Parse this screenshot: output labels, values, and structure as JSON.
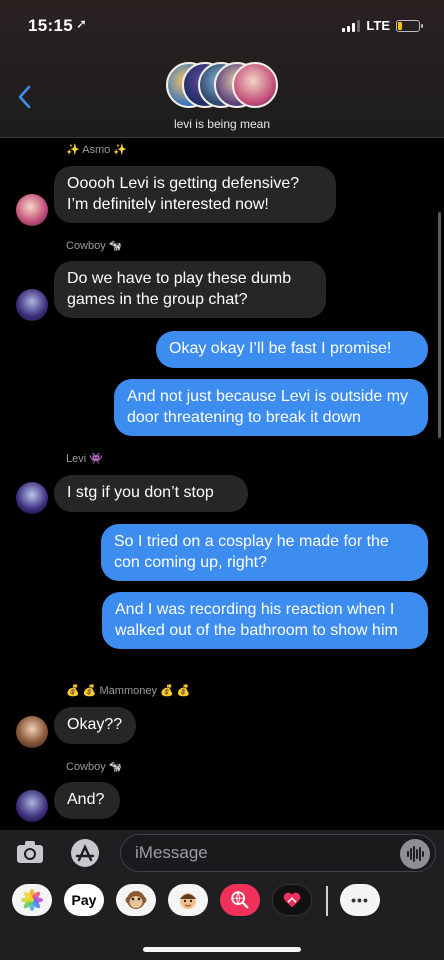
{
  "status_bar": {
    "time": "15:15",
    "network": "LTE",
    "battery_color": "#f2c200"
  },
  "header": {
    "group_name": "levi is being mean"
  },
  "messages": [
    {
      "sender": "✨ Asmo ✨",
      "from": "in",
      "text": "Ooooh Levi is getting defensive? I’m definitely interested now!"
    },
    {
      "sender": "Cowboy 🐄",
      "from": "in",
      "text": "Do we have to play these dumb games in the group chat?"
    },
    {
      "from": "out",
      "text": "Okay okay I’ll be fast I promise!"
    },
    {
      "from": "out",
      "text": "And not just because Levi is outside my door threatening to break it down"
    },
    {
      "sender": "Levi 👾",
      "from": "in",
      "text": "I stg if you don’t stop"
    },
    {
      "from": "out",
      "text": "So I tried on a cosplay he made for the con coming up, right?"
    },
    {
      "from": "out",
      "text": "And I was recording his reaction when I walked out of the bathroom to show him"
    },
    {
      "sender": "💰 💰 Mammoney 💰 💰",
      "from": "in",
      "text": "Okay??"
    },
    {
      "sender": "Cowboy 🐄",
      "from": "in",
      "text": "And?"
    }
  ],
  "input": {
    "placeholder": "iMessage"
  },
  "drawer": {
    "apps": [
      {
        "name": "photos-app",
        "icon": "photos-icon",
        "label": ""
      },
      {
        "name": "apple-pay-app",
        "icon": "apple-pay-icon",
        "label": "Pay"
      },
      {
        "name": "animoji-app",
        "icon": "monkey-icon",
        "label": ""
      },
      {
        "name": "memoji-app",
        "icon": "memoji-icon",
        "label": ""
      },
      {
        "name": "images-search-app",
        "icon": "globe-search-icon",
        "label": ""
      },
      {
        "name": "digital-touch-app",
        "icon": "heart-icon",
        "label": ""
      },
      {
        "name": "more-apps",
        "icon": "more-icon",
        "label": "•••"
      }
    ]
  },
  "colors": {
    "outgoing_bubble": "#3d8cf0",
    "incoming_bubble": "#262629",
    "background": "#000000"
  }
}
